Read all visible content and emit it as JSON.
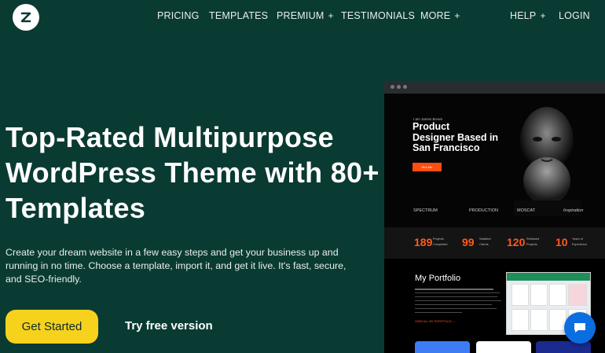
{
  "header": {
    "logo_icon": "z-logo-icon",
    "nav": [
      {
        "label": "PRICING",
        "has_plus": false
      },
      {
        "label": "TEMPLATES",
        "has_plus": false
      },
      {
        "label": "PREMIUM",
        "has_plus": true
      },
      {
        "label": "TESTIMONIALS",
        "has_plus": false
      },
      {
        "label": "MORE",
        "has_plus": true
      },
      {
        "label": "HELP",
        "has_plus": true
      },
      {
        "label": "LOGIN",
        "has_plus": false
      }
    ],
    "plus": "+"
  },
  "hero": {
    "title_lines": [
      "Top-Rated Multipurpose",
      "WordPress Theme with 80+",
      "Templates"
    ],
    "desc_lines": [
      "Create your dream website in a few easy steps and get your business up and",
      "running in no time. Choose a template, import it, and get it live. It's fast, secure,",
      "and SEO-friendly."
    ],
    "cta_primary": "Get Started",
    "cta_secondary": "Try free version"
  },
  "mockup": {
    "intro": "I am James Brown",
    "headline_lines": [
      "Product",
      "Designer Based in",
      "San Francisco"
    ],
    "button": "Hire Me",
    "brands": [
      "SPECTRUM",
      "PRODUCTION",
      "MOSCAT",
      "Inspiration"
    ],
    "stats": [
      {
        "value": "189",
        "label_lines": [
          "Projects",
          "Completed"
        ]
      },
      {
        "value": "99",
        "label_lines": [
          "Satisfied",
          "Clients"
        ]
      },
      {
        "value": "120",
        "label_lines": [
          "Released",
          "Projects"
        ]
      },
      {
        "value": "10",
        "label_lines": [
          "Years of",
          "Experience"
        ]
      }
    ],
    "portfolio_title": "My Portfolio",
    "portfolio_link": "VIEW ALL MY PORTFOLIO  →"
  },
  "colors": {
    "background": "#0a3b33",
    "cta_yellow": "#f7d21d",
    "accent_orange": "#ff5a1f",
    "chat_blue": "#0b6ee0"
  },
  "chat_icon": "chat-bubble-icon"
}
